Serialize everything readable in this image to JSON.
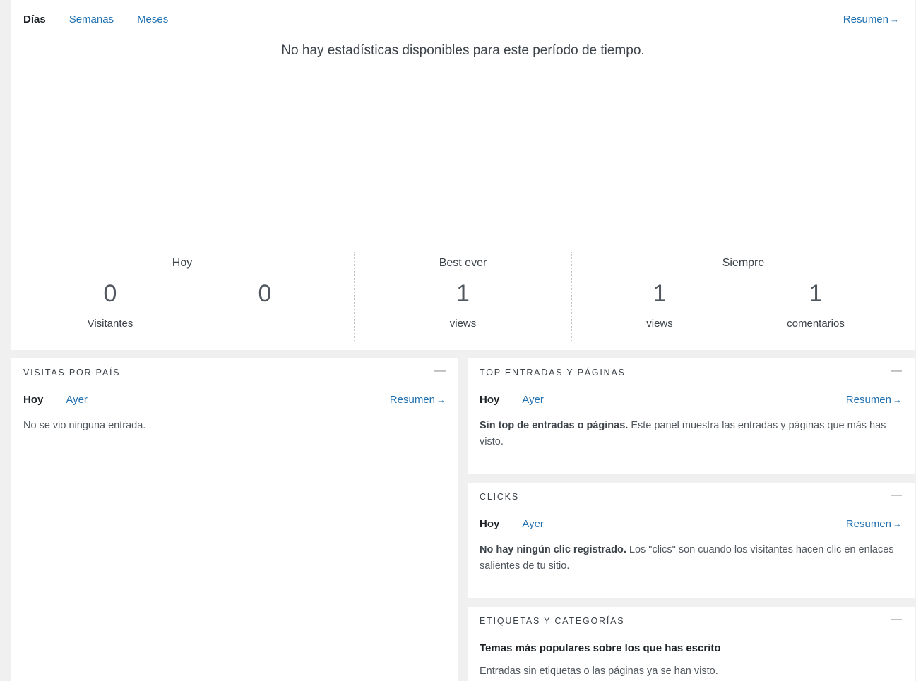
{
  "chart": {
    "tabs": [
      {
        "label": "Días",
        "active": true
      },
      {
        "label": "Semanas",
        "active": false
      },
      {
        "label": "Meses",
        "active": false
      }
    ],
    "summary_label": "Resumen",
    "empty_message": "No hay estadísticas disponibles para este período de tiempo."
  },
  "stats": {
    "today": {
      "title": "Hoy",
      "visitors_value": "0",
      "visitors_label": "Visitantes",
      "views_value": "0"
    },
    "best": {
      "title": "Best ever",
      "value": "1",
      "label": "views"
    },
    "always": {
      "title": "Siempre",
      "views_value": "1",
      "views_label": "views",
      "comments_value": "1",
      "comments_label": "comentarios"
    }
  },
  "country": {
    "title": "VISITAS POR PAÍS",
    "tab_today": "Hoy",
    "tab_yesterday": "Ayer",
    "summary_label": "Resumen",
    "body": "No se vio ninguna entrada."
  },
  "top_posts": {
    "title": "TOP ENTRADAS Y PÁGINAS",
    "tab_today": "Hoy",
    "tab_yesterday": "Ayer",
    "summary_label": "Resumen",
    "body_strong": "Sin top de entradas o páginas.",
    "body_rest": " Este panel muestra las entradas y páginas que más has visto."
  },
  "clicks": {
    "title": "CLICKS",
    "tab_today": "Hoy",
    "tab_yesterday": "Ayer",
    "summary_label": "Resumen",
    "body_strong": "No hay ningún clic registrado.",
    "body_rest": " Los \"clics\" son cuando los visitantes hacen clic en enlaces salientes de tu sitio."
  },
  "tags": {
    "title": "ETIQUETAS Y CATEGORÍAS",
    "heading": "Temas más populares sobre los que has escrito",
    "body": "Entradas sin etiquetas o las páginas ya se han visto."
  },
  "icons": {
    "arrow": "→",
    "collapse": "—"
  }
}
